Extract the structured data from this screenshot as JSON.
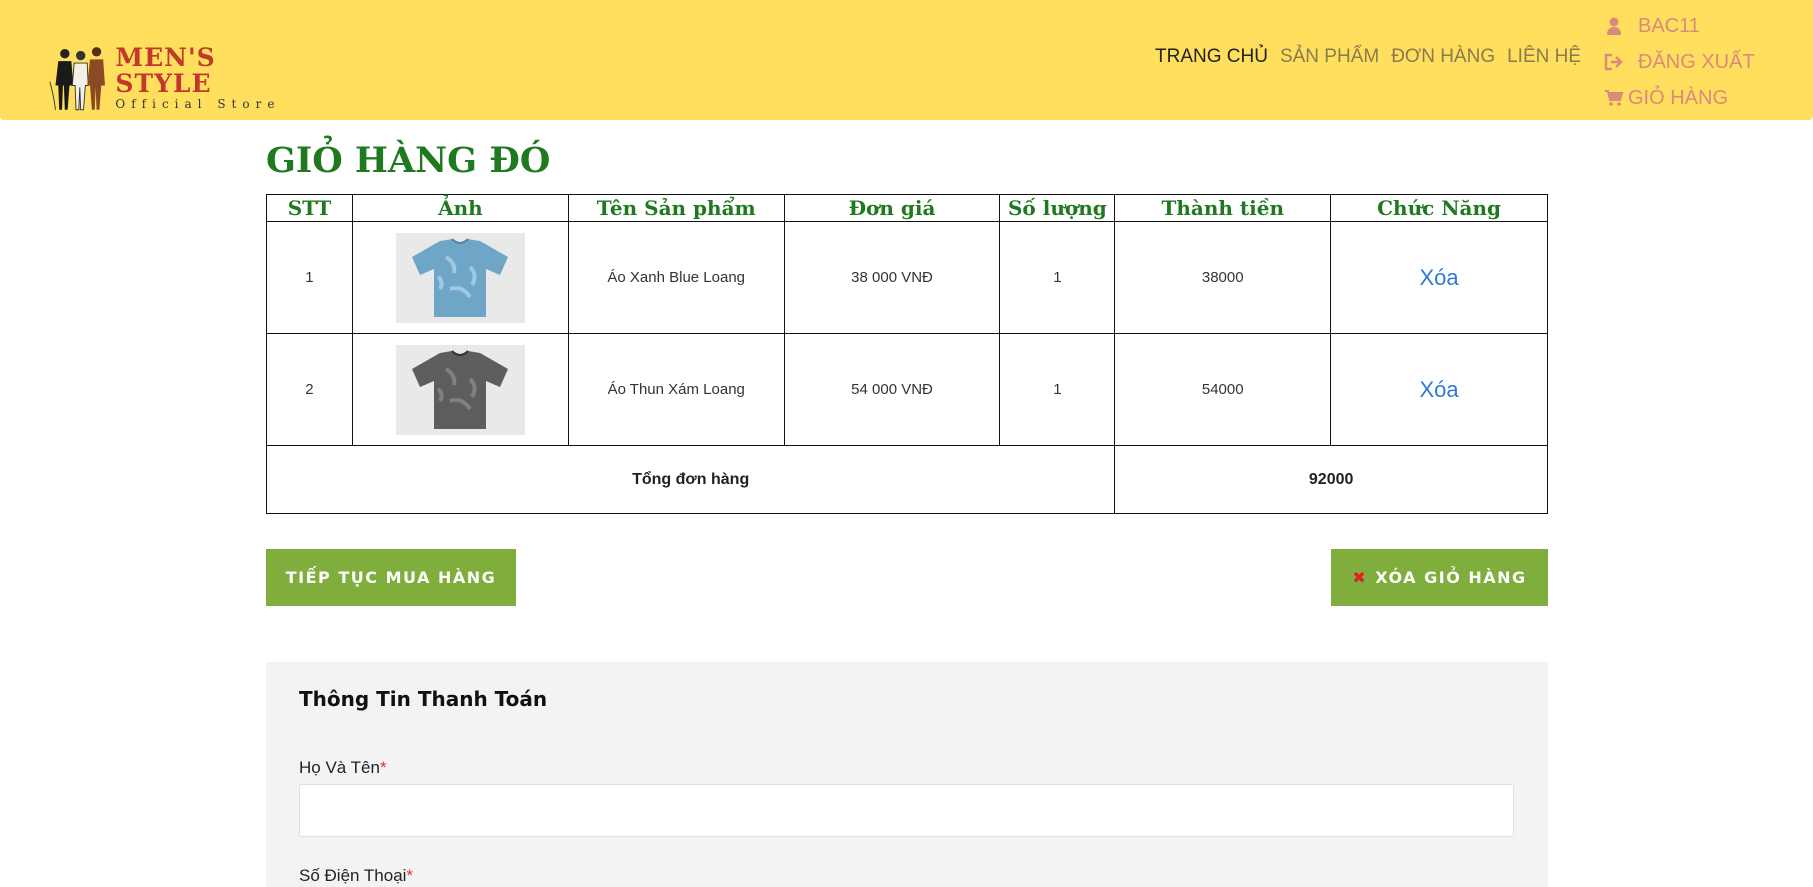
{
  "header": {
    "logo": {
      "title": "MEN'S STYLE",
      "subtitle": "Official Store"
    },
    "nav": [
      "TRANG CHỦ",
      "SẢN PHẨM",
      "ĐƠN HÀNG",
      "LIÊN HỆ"
    ],
    "user": {
      "username": "BAC11",
      "logout": "ĐĂNG XUẤT",
      "cart": "GIỎ HÀNG"
    }
  },
  "page_title": "GIỎ HÀNG ĐÓ",
  "table": {
    "headers": [
      "STT",
      "Ảnh",
      "Tên Sản phẩm",
      "Đơn giá",
      "Số lượng",
      "Thành tiền",
      "Chức Năng"
    ],
    "rows": [
      {
        "stt": "1",
        "name": "Áo Xanh Blue Loang",
        "price": "38 000 VNĐ",
        "qty": "1",
        "subtotal": "38000",
        "action": "Xóa"
      },
      {
        "stt": "2",
        "name": "Áo Thun Xám Loang",
        "price": "54 000 VNĐ",
        "qty": "1",
        "subtotal": "54000",
        "action": "Xóa"
      }
    ],
    "total_label": "Tổng đơn hàng",
    "total_value": "92000"
  },
  "buttons": {
    "continue": "TIẾP TỤC MUA HÀNG",
    "clear": "XÓA GIỎ HÀNG"
  },
  "billing": {
    "title": "Thông Tin Thanh Toán",
    "fields": [
      {
        "label": "Họ Và Tên",
        "required": "*",
        "value": ""
      },
      {
        "label": "Số Điện Thoại",
        "required": "*"
      }
    ]
  },
  "colors": {
    "header": "#ffdf5d",
    "title_green": "#1f7a1f",
    "button_green": "#7fae3c",
    "link_blue": "#2e7bd6"
  }
}
